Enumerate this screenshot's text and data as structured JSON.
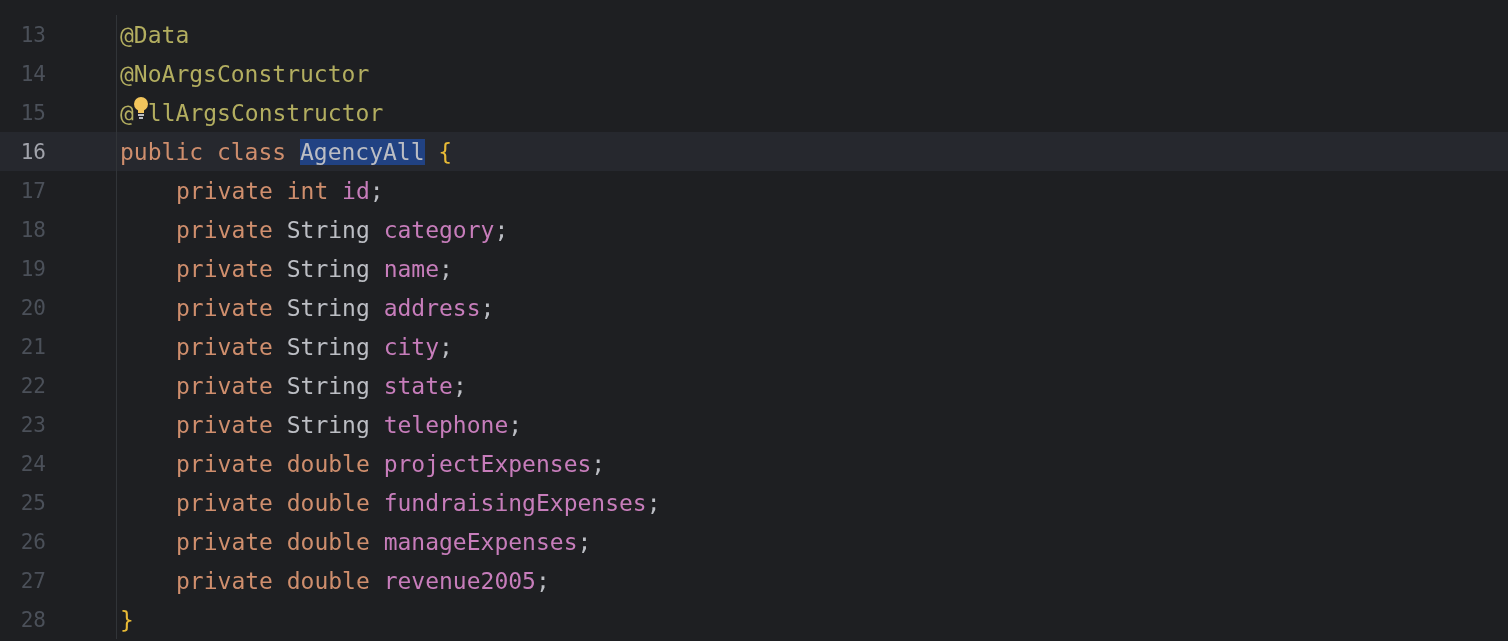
{
  "editor": {
    "lines": [
      {
        "number": "13",
        "current": false,
        "tokens": [
          {
            "kind": "annotation",
            "text": "@Data"
          }
        ]
      },
      {
        "number": "14",
        "current": false,
        "tokens": [
          {
            "kind": "annotation",
            "text": "@NoArgsConstructor"
          }
        ]
      },
      {
        "number": "15",
        "current": false,
        "tokens": [
          {
            "kind": "annotation",
            "text": "@"
          },
          {
            "kind": "bulb"
          },
          {
            "kind": "annotation",
            "text": "llArgsConstructor"
          }
        ]
      },
      {
        "number": "16",
        "current": true,
        "tokens": [
          {
            "kind": "keyword",
            "text": "public"
          },
          {
            "kind": "keyword",
            "text": "class"
          },
          {
            "kind": "classname",
            "text": "AgencyAll",
            "selected": true
          },
          {
            "kind": "brace",
            "text": "{"
          }
        ],
        "children": [
          {
            "number": "17",
            "current": false,
            "tokens": [
              {
                "kind": "keyword",
                "text": "private"
              },
              {
                "kind": "keyword",
                "text": "int"
              },
              {
                "kind": "field",
                "text": "id",
                "end": ";"
              }
            ]
          },
          {
            "number": "18",
            "current": false,
            "tokens": [
              {
                "kind": "keyword",
                "text": "private"
              },
              {
                "kind": "type",
                "text": "String"
              },
              {
                "kind": "field",
                "text": "category",
                "end": ";"
              }
            ]
          },
          {
            "number": "19",
            "current": false,
            "tokens": [
              {
                "kind": "keyword",
                "text": "private"
              },
              {
                "kind": "type",
                "text": "String"
              },
              {
                "kind": "field",
                "text": "name",
                "end": ";"
              }
            ]
          },
          {
            "number": "20",
            "current": false,
            "tokens": [
              {
                "kind": "keyword",
                "text": "private"
              },
              {
                "kind": "type",
                "text": "String"
              },
              {
                "kind": "field",
                "text": "address",
                "end": ";"
              }
            ]
          },
          {
            "number": "21",
            "current": false,
            "tokens": [
              {
                "kind": "keyword",
                "text": "private"
              },
              {
                "kind": "type",
                "text": "String"
              },
              {
                "kind": "field",
                "text": "city",
                "end": ";"
              }
            ]
          },
          {
            "number": "22",
            "current": false,
            "tokens": [
              {
                "kind": "keyword",
                "text": "private"
              },
              {
                "kind": "type",
                "text": "String"
              },
              {
                "kind": "field",
                "text": "state",
                "end": ";"
              }
            ]
          },
          {
            "number": "23",
            "current": false,
            "tokens": [
              {
                "kind": "keyword",
                "text": "private"
              },
              {
                "kind": "type",
                "text": "String"
              },
              {
                "kind": "field",
                "text": "telephone",
                "end": ";"
              }
            ]
          },
          {
            "number": "24",
            "current": false,
            "tokens": [
              {
                "kind": "keyword",
                "text": "private"
              },
              {
                "kind": "keyword",
                "text": "double"
              },
              {
                "kind": "field",
                "text": "projectExpenses",
                "end": ";"
              }
            ]
          },
          {
            "number": "25",
            "current": false,
            "tokens": [
              {
                "kind": "keyword",
                "text": "private"
              },
              {
                "kind": "keyword",
                "text": "double"
              },
              {
                "kind": "field",
                "text": "fundraisingExpenses",
                "end": ";"
              }
            ]
          },
          {
            "number": "26",
            "current": false,
            "tokens": [
              {
                "kind": "keyword",
                "text": "private"
              },
              {
                "kind": "keyword",
                "text": "double"
              },
              {
                "kind": "field",
                "text": "manageExpenses",
                "end": ";"
              }
            ]
          },
          {
            "number": "27",
            "current": false,
            "tokens": [
              {
                "kind": "keyword",
                "text": "private"
              },
              {
                "kind": "keyword",
                "text": "double"
              },
              {
                "kind": "field",
                "text": "revenue2005",
                "end": ";"
              }
            ]
          }
        ]
      },
      {
        "number": "28",
        "current": false,
        "tokens": [
          {
            "kind": "brace",
            "text": "}"
          }
        ]
      }
    ]
  }
}
